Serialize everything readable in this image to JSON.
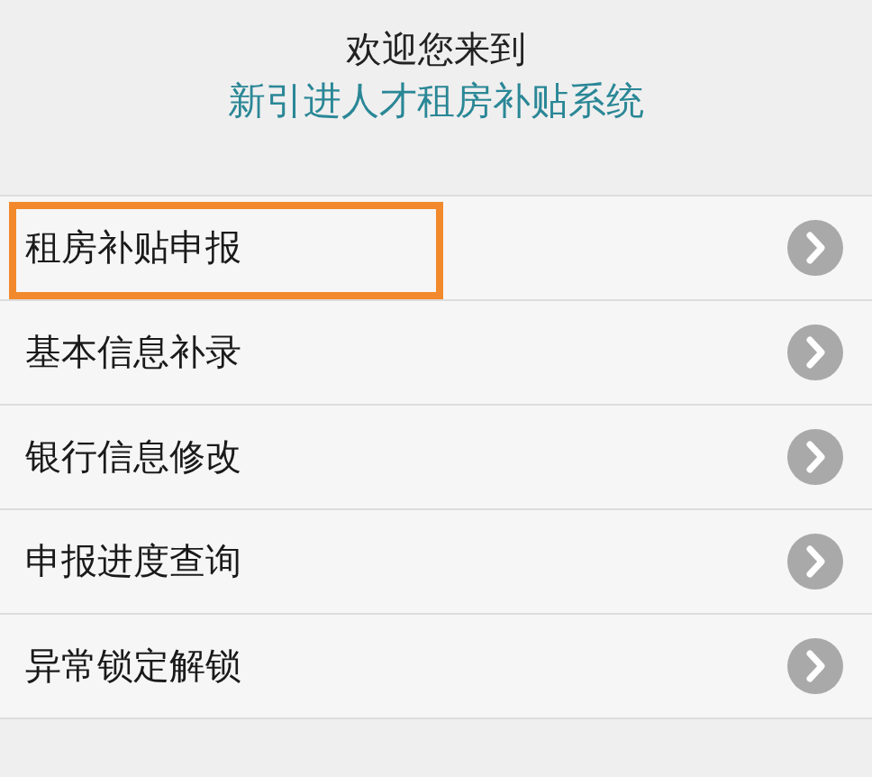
{
  "header": {
    "greeting": "欢迎您来到",
    "title": "新引进人才租房补贴系统"
  },
  "menu": [
    {
      "label": "租房补贴申报",
      "highlighted": true
    },
    {
      "label": "基本信息补录",
      "highlighted": false
    },
    {
      "label": "银行信息修改",
      "highlighted": false
    },
    {
      "label": "申报进度查询",
      "highlighted": false
    },
    {
      "label": "异常锁定解锁",
      "highlighted": false
    }
  ]
}
